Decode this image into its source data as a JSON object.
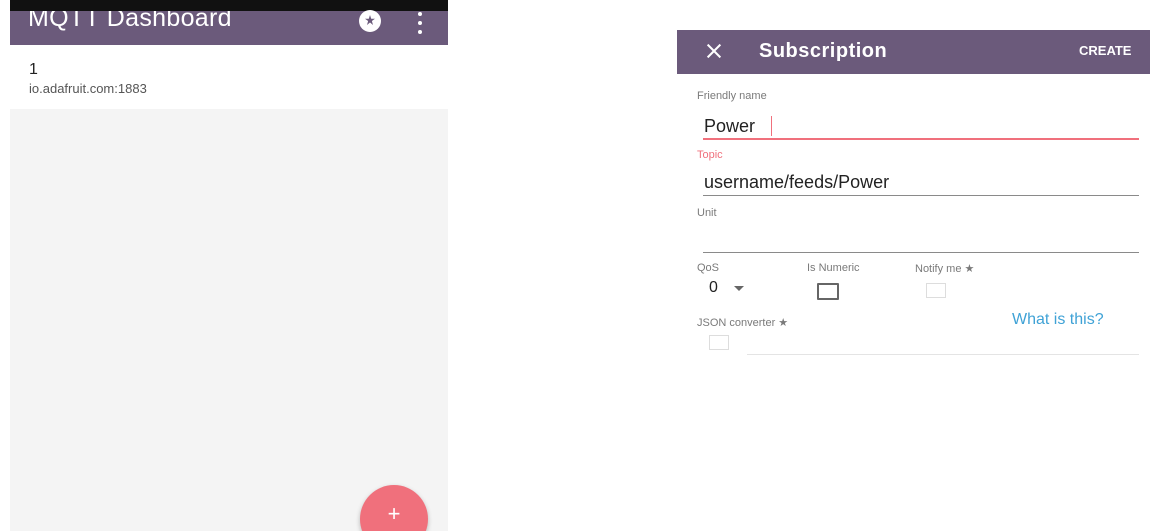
{
  "left": {
    "app_title": "MQTT Dashboard",
    "broker": {
      "name": "1",
      "host": "io.adafruit.com:1883"
    },
    "fab_label": "+",
    "colors": {
      "toolbar": "#6b5a7b",
      "fab": "#f0707c",
      "background": "#f4f4f4"
    }
  },
  "right": {
    "title": "Subscription",
    "create_label": "CREATE",
    "friendly_name": {
      "label": "Friendly name",
      "value": "Power"
    },
    "topic": {
      "label": "Topic",
      "value": "username/feeds/Power"
    },
    "unit": {
      "label": "Unit",
      "value": ""
    },
    "qos": {
      "label": "QoS",
      "value": "0"
    },
    "is_numeric": {
      "label": "Is Numeric",
      "checked": false
    },
    "notify_me": {
      "label": "Notify me ★",
      "checked": false
    },
    "json_converter": {
      "label": "JSON converter ★",
      "checked": false
    },
    "what_is_this": "What is this?",
    "colors": {
      "toolbar": "#6b5a7b",
      "accent": "#f0707c",
      "link": "#3fa2d6"
    }
  }
}
